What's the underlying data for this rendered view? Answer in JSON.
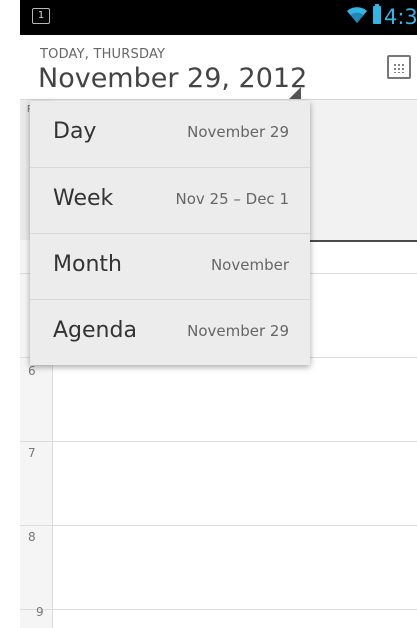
{
  "status_bar": {
    "left_icon_text": "1",
    "time": "4:3",
    "wifi_icon": "wifi-icon",
    "battery_icon": "battery-icon",
    "accent_color": "#33b5e5"
  },
  "header": {
    "today_label": "TODAY, THURSDAY",
    "date_label": "November 29, 2012",
    "calendar_icon": "calendar-icon"
  },
  "background": {
    "side_label": "F",
    "hours": [
      "6",
      "7",
      "8",
      "9"
    ]
  },
  "view_menu": {
    "items": [
      {
        "label": "Day",
        "value": "November 29"
      },
      {
        "label": "Week",
        "value": "Nov 25 – Dec 1"
      },
      {
        "label": "Month",
        "value": "November"
      },
      {
        "label": "Agenda",
        "value": "November 29"
      }
    ]
  }
}
